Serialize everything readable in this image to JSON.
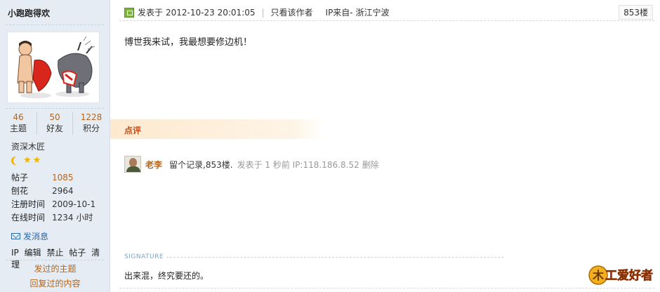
{
  "sidebar": {
    "username": "小跑跑得欢",
    "stats": [
      {
        "num": "46",
        "label": "主题"
      },
      {
        "num": "50",
        "label": "好友"
      },
      {
        "num": "1228",
        "label": "积分"
      }
    ],
    "rank": "资深木匠",
    "info": [
      {
        "key": "帖子",
        "value": "1085"
      },
      {
        "key": "刨花",
        "value": "2964"
      },
      {
        "key": "注册时间",
        "value": "2009-10-1"
      },
      {
        "key": "在线时间",
        "value": "1234 小时"
      }
    ],
    "send_message": "发消息",
    "mod_actions": [
      "IP",
      "编辑",
      "禁止",
      "帖子",
      "清理"
    ],
    "link_topics": "发过的主题",
    "link_replies": "回复过的内容"
  },
  "post": {
    "posted_label": "发表于",
    "posted_time": "2012-10-23 20:01:05",
    "only_author": "只看该作者",
    "ip_from": "IP来自- 浙江宁波",
    "floor": "853楼",
    "content": "博世我来试，我最想要修边机！"
  },
  "review": {
    "label": "点评",
    "comment": {
      "name": "老李",
      "text": "留个记录,853楼.",
      "meta": "发表于 1 秒前 IP:118.186.8.52",
      "delete": "删除"
    }
  },
  "signature": {
    "label": "SIGNATURE",
    "text": "出来混，终究要还的。"
  },
  "logo": {
    "text": "木工爱好者"
  },
  "colors": {
    "sidebar_bg": "#e6ecf3",
    "accent_orange": "#b5651d",
    "link_blue": "#2a64a8",
    "review_bg": "#fde9cf"
  }
}
